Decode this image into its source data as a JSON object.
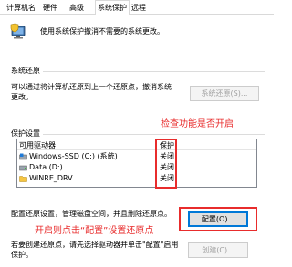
{
  "tabs": [
    {
      "label": "计算机名",
      "active": false
    },
    {
      "label": "硬件",
      "active": false
    },
    {
      "label": "高级",
      "active": false
    },
    {
      "label": "系统保护",
      "active": true
    },
    {
      "label": "远程",
      "active": false
    }
  ],
  "intro_text": "使用系统保护撤消不需要的系统更改。",
  "icon": "shield-computer-icon",
  "system_restore": {
    "title": "系统还原",
    "description": "可以通过将计算机还原到上一个还原点，撤消系统更改。",
    "button_label": "系统还原(S)..."
  },
  "protection_settings": {
    "title": "保护设置",
    "columns": {
      "drive": "可用驱动器",
      "protection": "保护"
    },
    "drives": [
      {
        "name": "Windows-SSD (C:) (系统)",
        "protection": "关闭",
        "icon": "system-drive-icon"
      },
      {
        "name": "Data (D:)",
        "protection": "关闭",
        "icon": "drive-icon"
      },
      {
        "name": "WINRE_DRV",
        "protection": "关闭",
        "icon": "folder-drive-icon"
      }
    ],
    "config_description": "配置还原设置，管理磁盘空间，并且删除还原点。",
    "config_button_label": "配置(O)...",
    "create_description": "若要创建还原点，请先选择驱动器并单击\"配置\"启用保护。",
    "create_button_label": "创建(C)..."
  },
  "annotations": {
    "check_note": "检查功能是否开启",
    "config_note": "开启则点击“配置”设置还原点"
  },
  "colors": {
    "annotation_red": "#e82c2c",
    "button_bg": "#e1e1e1",
    "default_button_border": "#0078d7"
  }
}
